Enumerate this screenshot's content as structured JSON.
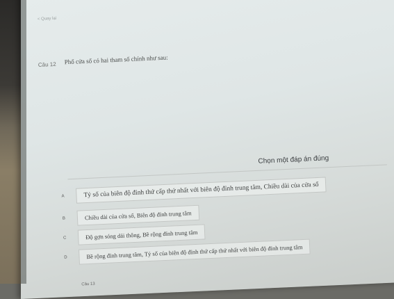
{
  "header": {
    "small_label": "< Quay lại"
  },
  "question": {
    "number": "Câu 12",
    "text": "Phổ cửa sổ có hai tham số chính như sau:"
  },
  "hint": "Chọn một đáp án đúng",
  "options": [
    {
      "letter": "A",
      "text": "Tỷ số của biên độ đỉnh thứ cấp thứ nhất với biên độ đỉnh trung tâm, Chiều dài của cửa sổ"
    },
    {
      "letter": "B",
      "text": "Chiều dài của cửa sổ, Biên độ đỉnh trung tâm"
    },
    {
      "letter": "C",
      "text": "Độ gợn sóng dải thông, Bề rộng đỉnh trung tâm"
    },
    {
      "letter": "D",
      "text": "Bề rộng đỉnh trung tâm, Tỷ số của biên độ đỉnh thứ cấp thứ nhất với biên độ đỉnh trung tâm"
    }
  ],
  "next_question": "Câu 13"
}
